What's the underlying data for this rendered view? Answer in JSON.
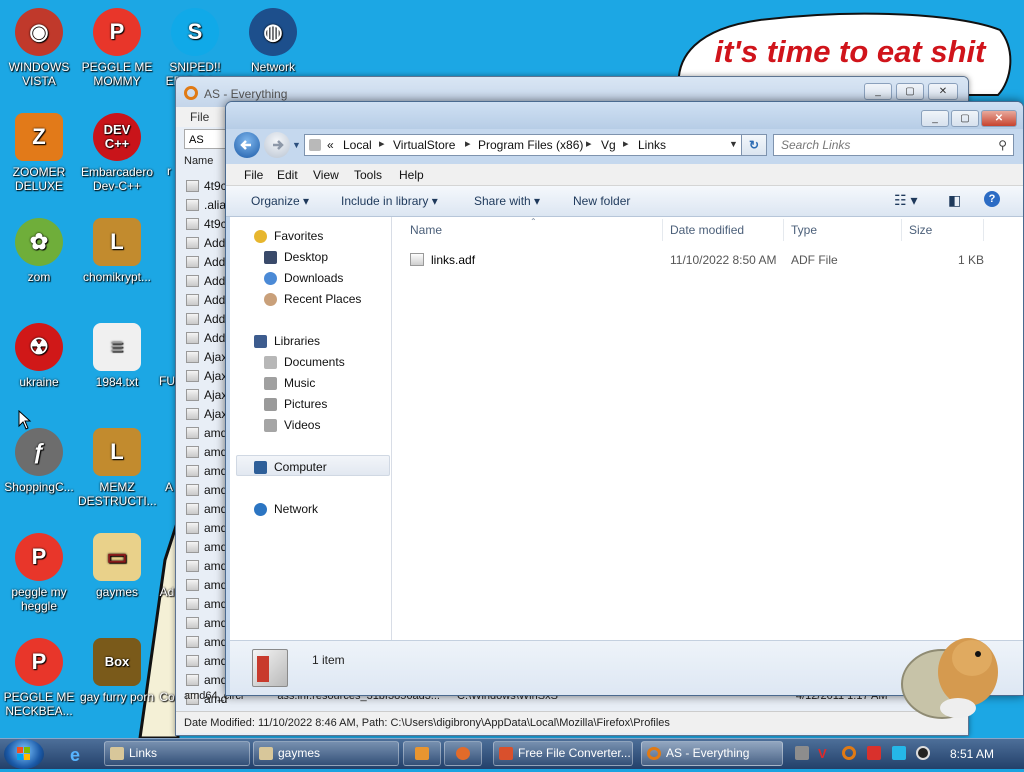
{
  "desktop": {
    "banner_text": "it's time to eat shit",
    "icons": [
      {
        "label": "WINDOWS VISTA",
        "icon": "vista-bowl-icon",
        "color": "#c0392b"
      },
      {
        "label": "PEGGLE ME MOMMY",
        "icon": "peggle-icon",
        "color": "#e8362a"
      },
      {
        "label": "SNIPED!! EPIC GA...",
        "icon": "skype-icon",
        "color": "#10a9e8"
      },
      {
        "label": "Network",
        "icon": "network-globe-icon",
        "color": "#c84a1e"
      },
      {
        "label": "ZOOMER DELUXE",
        "icon": "zoomer-icon",
        "color": "#e27a19"
      },
      {
        "label": "Embarcadero Dev-C++",
        "icon": "devcpp-icon",
        "color": "#c9141a"
      },
      {
        "label": "zom",
        "icon": "flower-icon",
        "color": "#6fae3a"
      },
      {
        "label": "chomikrypt...",
        "icon": "clock-app-icon",
        "color": "#c28b2e"
      },
      {
        "label": "ukraine",
        "icon": "radiation-icon",
        "color": "#d01818"
      },
      {
        "label": "1984.txt",
        "icon": "text-file-icon",
        "color": "#e8e8e8"
      },
      {
        "label": "ShoppingC...",
        "icon": "flash-icon",
        "color": "#6d6d6d"
      },
      {
        "label": "MEMZ DESTRUCTI...",
        "icon": "memz-icon",
        "color": "#c28b2e"
      },
      {
        "label": "peggle my heggle",
        "icon": "peggle-icon",
        "color": "#e8362a"
      },
      {
        "label": "gaymes",
        "icon": "folder-icon",
        "color": "#e9d18a"
      },
      {
        "label": "PEGGLE ME NECKBEA...",
        "icon": "peggle-icon",
        "color": "#e8362a"
      },
      {
        "label": "gay furry porn",
        "icon": "gopher-box-icon",
        "color": "#7a5a1a"
      }
    ],
    "partial_labels": [
      "r",
      "FU",
      "A",
      "Ad",
      "Co"
    ]
  },
  "everything_window": {
    "title": "AS - Everything",
    "menu_file": "File",
    "search_value": "AS",
    "column_name": "Name",
    "rows": [
      "4t9c",
      ".alia",
      "4t9c",
      "Add",
      "Add",
      "Add",
      "Add",
      "Add",
      "Add",
      "Ajax",
      "Ajax",
      "Ajax",
      "Ajax",
      "amd",
      "amd",
      "amd",
      "amd",
      "amd",
      "amd",
      "amd",
      "amd",
      "amd",
      "amd",
      "amd",
      "amd",
      "amd",
      "amd",
      "amd"
    ],
    "bottom_row_name": "amd64_circl",
    "bottom_row_rest": "ass.inf.resources_31bf3856ad3...",
    "bottom_row_path": "C:\\Windows\\WinSxS",
    "bottom_row_date": "4/12/2011 1:17 AM",
    "status": "Date Modified: 11/10/2022 8:46 AM, Path: C:\\Users\\digibrony\\AppData\\Local\\Mozilla\\Firefox\\Profiles"
  },
  "explorer": {
    "breadcrumbs": [
      "«",
      "Local",
      "VirtualStore",
      "Program Files (x86)",
      "Vg",
      "Links"
    ],
    "search_placeholder": "Search Links",
    "menus": [
      "File",
      "Edit",
      "View",
      "Tools",
      "Help"
    ],
    "commands": [
      "Organize",
      "Include in library",
      "Share with",
      "New folder"
    ],
    "nav": {
      "favorites": "Favorites",
      "desktop": "Desktop",
      "downloads": "Downloads",
      "recent": "Recent Places",
      "libraries": "Libraries",
      "documents": "Documents",
      "music": "Music",
      "pictures": "Pictures",
      "videos": "Videos",
      "computer": "Computer",
      "network": "Network"
    },
    "columns": {
      "name": "Name",
      "date": "Date modified",
      "type": "Type",
      "size": "Size"
    },
    "files": [
      {
        "name": "links.adf",
        "date": "11/10/2022 8:50 AM",
        "type": "ADF File",
        "size": "1 KB"
      }
    ],
    "item_count": "1 item"
  },
  "taskbar": {
    "items": [
      "Links",
      "gaymes",
      "",
      "",
      "Free File Converter...",
      "AS - Everything"
    ],
    "clock": "8:51 AM"
  }
}
